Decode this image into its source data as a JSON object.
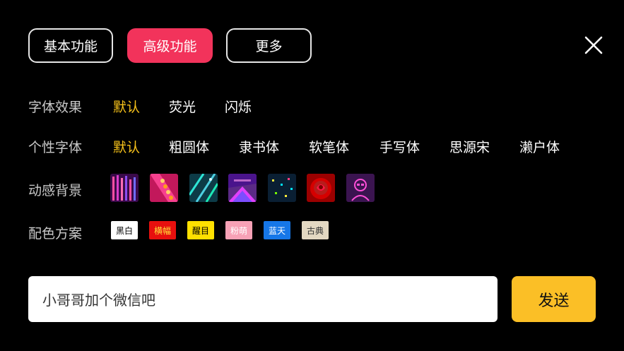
{
  "tabs": [
    {
      "label": "基本功能"
    },
    {
      "label": "高级功能"
    },
    {
      "label": "更多"
    }
  ],
  "font_effect": {
    "label": "字体效果",
    "options": [
      "默认",
      "荧光",
      "闪烁"
    ],
    "selected": "默认"
  },
  "font_style": {
    "label": "个性字体",
    "options": [
      "默认",
      "粗圆体",
      "隶书体",
      "软笔体",
      "手写体",
      "思源宋",
      "濑户体"
    ],
    "selected": "默认"
  },
  "dynamic_bg": {
    "label": "动感背景",
    "thumbnails": [
      "pink-light-columns",
      "pink-orb-strip",
      "teal-diagonal-lights",
      "purple-tunnel",
      "dark-confetti",
      "red-rose",
      "neon-portrait"
    ]
  },
  "color_scheme": {
    "label": "配色方案",
    "swatches": [
      {
        "label": "黑白",
        "bg": "#ffffff",
        "fg": "#000000"
      },
      {
        "label": "横幅",
        "bg": "#e8100e",
        "fg": "#ffe13a"
      },
      {
        "label": "醒目",
        "bg": "#ffe000",
        "fg": "#000000"
      },
      {
        "label": "粉萌",
        "bg": "#f7a1b6",
        "fg": "#ffffff"
      },
      {
        "label": "蓝天",
        "bg": "#1677e8",
        "fg": "#ffffff"
      },
      {
        "label": "古典",
        "bg": "#e3d8c2",
        "fg": "#333333"
      }
    ]
  },
  "message_input": {
    "value": "小哥哥加个微信吧"
  },
  "send_label": "发送",
  "colors": {
    "accent": "#f2335b",
    "selected_text": "#f7c21a",
    "send_bg": "#fbbf26"
  }
}
